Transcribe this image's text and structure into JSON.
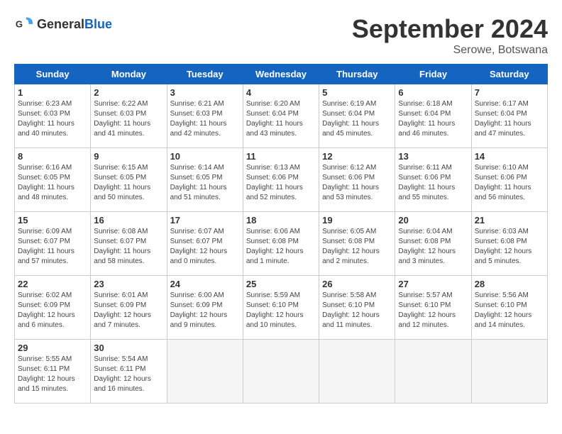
{
  "header": {
    "logo_general": "General",
    "logo_blue": "Blue",
    "month_title": "September 2024",
    "location": "Serowe, Botswana"
  },
  "days_of_week": [
    "Sunday",
    "Monday",
    "Tuesday",
    "Wednesday",
    "Thursday",
    "Friday",
    "Saturday"
  ],
  "weeks": [
    [
      {
        "day": "1",
        "sunrise": "6:23 AM",
        "sunset": "6:03 PM",
        "daylight": "11 hours and 40 minutes."
      },
      {
        "day": "2",
        "sunrise": "6:22 AM",
        "sunset": "6:03 PM",
        "daylight": "11 hours and 41 minutes."
      },
      {
        "day": "3",
        "sunrise": "6:21 AM",
        "sunset": "6:03 PM",
        "daylight": "11 hours and 42 minutes."
      },
      {
        "day": "4",
        "sunrise": "6:20 AM",
        "sunset": "6:04 PM",
        "daylight": "11 hours and 43 minutes."
      },
      {
        "day": "5",
        "sunrise": "6:19 AM",
        "sunset": "6:04 PM",
        "daylight": "11 hours and 45 minutes."
      },
      {
        "day": "6",
        "sunrise": "6:18 AM",
        "sunset": "6:04 PM",
        "daylight": "11 hours and 46 minutes."
      },
      {
        "day": "7",
        "sunrise": "6:17 AM",
        "sunset": "6:04 PM",
        "daylight": "11 hours and 47 minutes."
      }
    ],
    [
      {
        "day": "8",
        "sunrise": "6:16 AM",
        "sunset": "6:05 PM",
        "daylight": "11 hours and 48 minutes."
      },
      {
        "day": "9",
        "sunrise": "6:15 AM",
        "sunset": "6:05 PM",
        "daylight": "11 hours and 50 minutes."
      },
      {
        "day": "10",
        "sunrise": "6:14 AM",
        "sunset": "6:05 PM",
        "daylight": "11 hours and 51 minutes."
      },
      {
        "day": "11",
        "sunrise": "6:13 AM",
        "sunset": "6:06 PM",
        "daylight": "11 hours and 52 minutes."
      },
      {
        "day": "12",
        "sunrise": "6:12 AM",
        "sunset": "6:06 PM",
        "daylight": "11 hours and 53 minutes."
      },
      {
        "day": "13",
        "sunrise": "6:11 AM",
        "sunset": "6:06 PM",
        "daylight": "11 hours and 55 minutes."
      },
      {
        "day": "14",
        "sunrise": "6:10 AM",
        "sunset": "6:06 PM",
        "daylight": "11 hours and 56 minutes."
      }
    ],
    [
      {
        "day": "15",
        "sunrise": "6:09 AM",
        "sunset": "6:07 PM",
        "daylight": "11 hours and 57 minutes."
      },
      {
        "day": "16",
        "sunrise": "6:08 AM",
        "sunset": "6:07 PM",
        "daylight": "11 hours and 58 minutes."
      },
      {
        "day": "17",
        "sunrise": "6:07 AM",
        "sunset": "6:07 PM",
        "daylight": "12 hours and 0 minutes."
      },
      {
        "day": "18",
        "sunrise": "6:06 AM",
        "sunset": "6:08 PM",
        "daylight": "12 hours and 1 minute."
      },
      {
        "day": "19",
        "sunrise": "6:05 AM",
        "sunset": "6:08 PM",
        "daylight": "12 hours and 2 minutes."
      },
      {
        "day": "20",
        "sunrise": "6:04 AM",
        "sunset": "6:08 PM",
        "daylight": "12 hours and 3 minutes."
      },
      {
        "day": "21",
        "sunrise": "6:03 AM",
        "sunset": "6:08 PM",
        "daylight": "12 hours and 5 minutes."
      }
    ],
    [
      {
        "day": "22",
        "sunrise": "6:02 AM",
        "sunset": "6:09 PM",
        "daylight": "12 hours and 6 minutes."
      },
      {
        "day": "23",
        "sunrise": "6:01 AM",
        "sunset": "6:09 PM",
        "daylight": "12 hours and 7 minutes."
      },
      {
        "day": "24",
        "sunrise": "6:00 AM",
        "sunset": "6:09 PM",
        "daylight": "12 hours and 9 minutes."
      },
      {
        "day": "25",
        "sunrise": "5:59 AM",
        "sunset": "6:10 PM",
        "daylight": "12 hours and 10 minutes."
      },
      {
        "day": "26",
        "sunrise": "5:58 AM",
        "sunset": "6:10 PM",
        "daylight": "12 hours and 11 minutes."
      },
      {
        "day": "27",
        "sunrise": "5:57 AM",
        "sunset": "6:10 PM",
        "daylight": "12 hours and 12 minutes."
      },
      {
        "day": "28",
        "sunrise": "5:56 AM",
        "sunset": "6:10 PM",
        "daylight": "12 hours and 14 minutes."
      }
    ],
    [
      {
        "day": "29",
        "sunrise": "5:55 AM",
        "sunset": "6:11 PM",
        "daylight": "12 hours and 15 minutes."
      },
      {
        "day": "30",
        "sunrise": "5:54 AM",
        "sunset": "6:11 PM",
        "daylight": "12 hours and 16 minutes."
      },
      null,
      null,
      null,
      null,
      null
    ]
  ],
  "labels": {
    "sunrise_prefix": "Sunrise: ",
    "sunset_prefix": "Sunset: ",
    "daylight_prefix": "Daylight: "
  }
}
